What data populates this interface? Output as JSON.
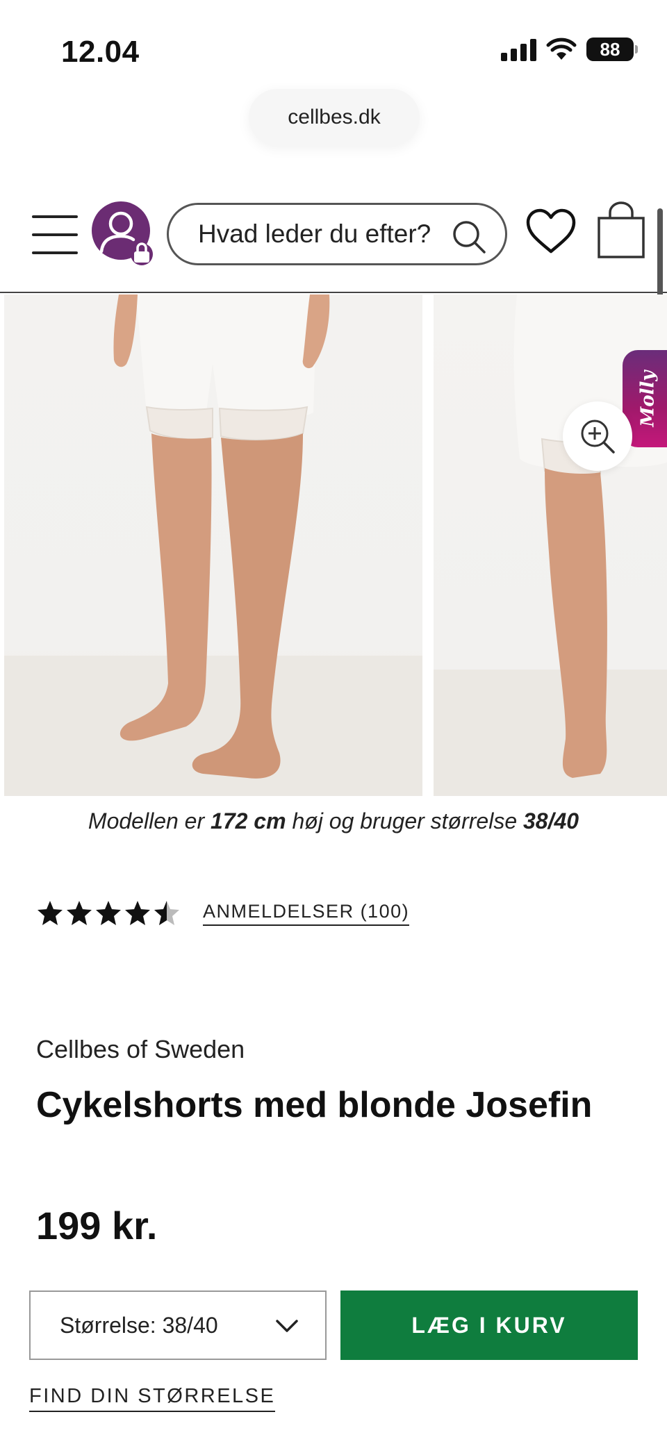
{
  "status_bar": {
    "time": "12.04",
    "battery": "88",
    "icons": [
      "signal-icon",
      "wifi-icon",
      "battery-icon"
    ]
  },
  "browser": {
    "url": "cellbes.dk"
  },
  "header": {
    "search_placeholder": "Hvad leder du efter?",
    "icons": [
      "menu-icon",
      "account-lock-icon",
      "search-icon",
      "heart-icon",
      "shopping-bag-icon"
    ],
    "avatar_color": "#6b2c73"
  },
  "gallery": {
    "images": [
      "product-front-image",
      "product-side-image"
    ],
    "molly_tab": "Molly"
  },
  "model_info": {
    "prefix": "Modellen er ",
    "height": "172 cm",
    "middle": " høj og bruger størrelse ",
    "size": "38/40"
  },
  "rating": {
    "value": 4.5,
    "max": 5,
    "reviews_label": "ANMELDELSER (100)"
  },
  "product": {
    "brand": "Cellbes of Sweden",
    "title": "Cykelshorts med blonde Josefin",
    "price": "199 kr."
  },
  "actions": {
    "size_label": "Størrelse: 38/40",
    "add_to_cart": "LÆG I KURV",
    "find_size": "FIND DIN STØRRELSE",
    "button_color": "#0f7d3e"
  }
}
